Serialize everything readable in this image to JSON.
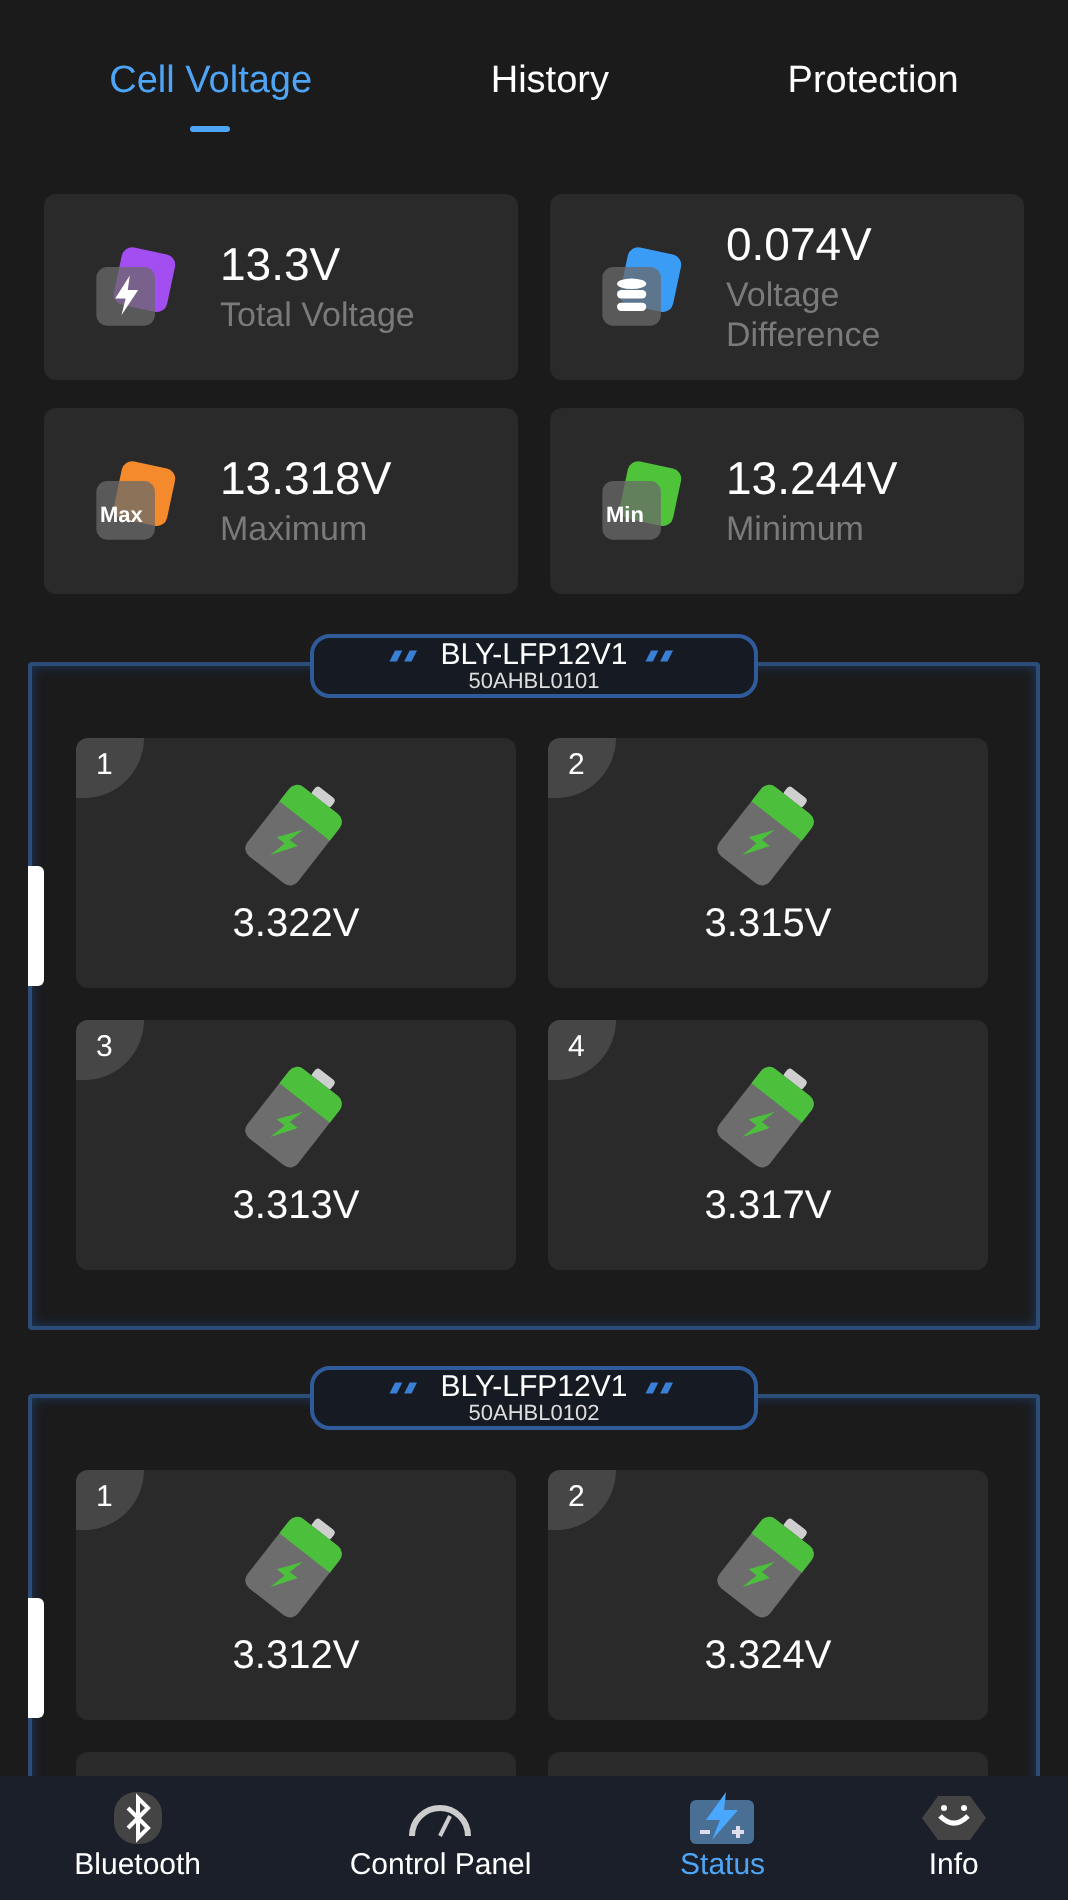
{
  "tabs": [
    {
      "label": "Cell Voltage",
      "selected": true
    },
    {
      "label": "History",
      "selected": false
    },
    {
      "label": "Protection",
      "selected": false
    }
  ],
  "summary": [
    {
      "kind": "total",
      "value": "13.3V",
      "label": "Total Voltage"
    },
    {
      "kind": "difference",
      "value": "0.074V",
      "label": "Voltage Difference"
    },
    {
      "kind": "max",
      "value": "13.318V",
      "label": "Maximum",
      "icon_text": "Max"
    },
    {
      "kind": "min",
      "value": "13.244V",
      "label": "Minimum",
      "icon_text": "Min"
    }
  ],
  "packs": [
    {
      "name": "BLY-LFP12V1",
      "name_line_2": "50AHBL0101",
      "cells": [
        {
          "kind": "cell",
          "number": "1",
          "voltage": "3.322V"
        },
        {
          "kind": "cell",
          "number": "2",
          "voltage": "3.315V"
        },
        {
          "kind": "cell",
          "number": "3",
          "voltage": "3.313V"
        },
        {
          "kind": "cell",
          "number": "4",
          "voltage": "3.317V"
        }
      ]
    },
    {
      "name": "BLY-LFP12V1",
      "name_line_2": "50AHBL0102",
      "cells": [
        {
          "kind": "cell",
          "number": "1",
          "voltage": "3.312V"
        },
        {
          "kind": "cell",
          "number": "2",
          "voltage": "3.324V"
        },
        {
          "kind": "partial"
        },
        {
          "kind": "partial"
        }
      ]
    }
  ],
  "nav": [
    {
      "kind": "bluetooth",
      "label": "Bluetooth",
      "selected": false
    },
    {
      "kind": "gauge",
      "label": "Control Panel",
      "selected": false
    },
    {
      "kind": "battery",
      "label": "Status",
      "selected": true
    },
    {
      "kind": "face",
      "label": "Info",
      "selected": false
    }
  ]
}
